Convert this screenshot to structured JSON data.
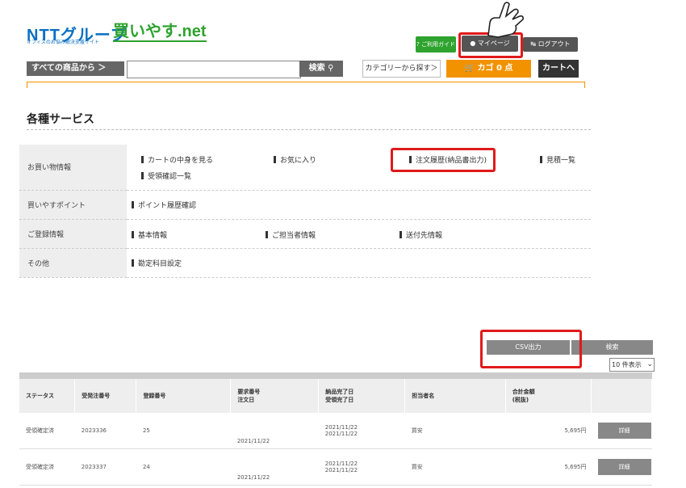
{
  "header": {
    "logo_ntt": "NTTグループ",
    "logo_sub": "オフィスのお悩み解決支援サイト",
    "logo_brand": "買いやす.net",
    "guide": "? ご利用ガイド",
    "mypage": "マイページ",
    "logout": "ログアウト"
  },
  "search": {
    "all_products": "すべての商品から ＞",
    "placeholder": "",
    "button": "検索",
    "category": "カテゴリーから探す＞",
    "cart": "カゴ 0 点",
    "to_cart": "カートへ"
  },
  "section": {
    "title": "各種サービス",
    "rows": [
      {
        "category": "お買い物情報",
        "links": [
          "カートの中身を見る",
          "お気に入り",
          "注文履歴(納品書出力)",
          "見積一覧",
          "受領確認一覧"
        ]
      },
      {
        "category": "買いやすポイント",
        "links": [
          "ポイント履歴確認"
        ]
      },
      {
        "category": "ご登録情報",
        "links": [
          "基本情報",
          "ご担当者情報",
          "送付先情報"
        ]
      },
      {
        "category": "その他",
        "links": [
          "勘定科目設定"
        ]
      }
    ]
  },
  "actions": {
    "csv": "CSV出力",
    "search": "検索",
    "per_page": "10 件表示"
  },
  "orders": {
    "headers": [
      "ステータス",
      "受発注番号",
      "登録番号",
      "要求番号",
      "注文日",
      "納品完了日",
      "受領完了日",
      "担当者名",
      "合計金額",
      "(税抜)"
    ],
    "rows": [
      {
        "status": "受領確定済",
        "order_no": "2023336",
        "reg_no": "25",
        "order_date": "2021/11/22",
        "delivered": "2021/11/22",
        "received": "2021/11/22",
        "person": "買安",
        "total": "5,695円",
        "detail": "詳細"
      },
      {
        "status": "受領確定済",
        "order_no": "2023337",
        "reg_no": "24",
        "order_date": "2021/11/22",
        "delivered": "2021/11/22",
        "received": "2021/11/22",
        "person": "買安",
        "total": "5,695円",
        "detail": "詳細"
      }
    ]
  },
  "colors": {
    "brand_green": "#2ea32e",
    "ntt_blue": "#0a6fc2",
    "cart_orange": "#f39200",
    "highlight_red": "#e01a1a"
  }
}
